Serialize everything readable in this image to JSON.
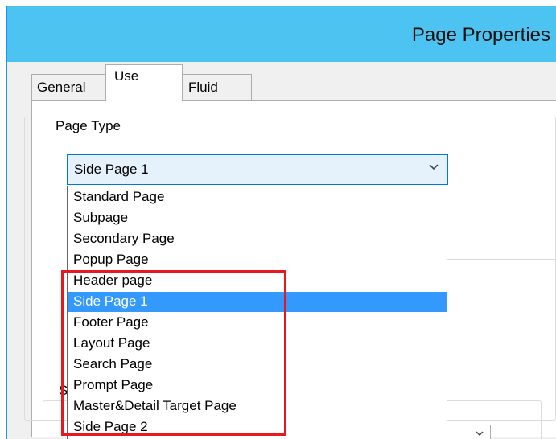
{
  "window": {
    "title": "Page Properties"
  },
  "tabs": [
    {
      "label": "General"
    },
    {
      "label": "Use"
    },
    {
      "label": "Fluid"
    }
  ],
  "page_type_group": {
    "legend": "Page Type",
    "selected_value": "Side Page 1",
    "options": [
      "Standard Page",
      "Subpage",
      "Secondary Page",
      "Popup Page",
      "Header page",
      "Side Page 1",
      "Footer Page",
      "Layout Page",
      "Search Page",
      "Prompt Page",
      "Master&Detail Target Page",
      "Side Page 2"
    ],
    "selected_index": 5
  },
  "second_group": {
    "legend_fragment": "S"
  },
  "icons": {
    "combo_arrow": "chevron-down-icon"
  },
  "colors": {
    "titlebar": "#4cc3f0",
    "selection": "#3399ff",
    "highlight": "#e8181e"
  }
}
